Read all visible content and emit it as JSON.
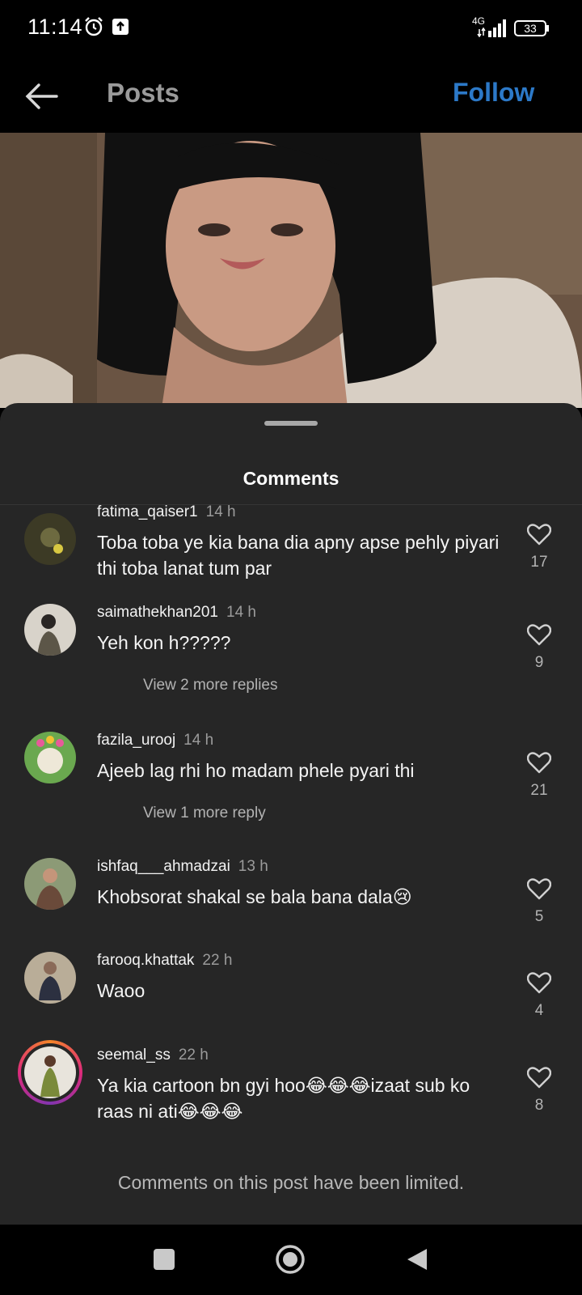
{
  "status_bar": {
    "time": "11:14",
    "network": "4G",
    "battery": "33"
  },
  "header": {
    "title": "Posts",
    "follow_label": "Follow"
  },
  "sheet": {
    "title": "Comments",
    "limited_notice": "Comments on this post have been limited."
  },
  "comments": [
    {
      "username": "fatima_qaiser1",
      "time": "14 h",
      "text": "Toba toba ye kia bana dia apny apse pehly piyari thi toba lanat tum par",
      "likes": "17"
    },
    {
      "username": "saimathekhan201",
      "time": "14 h",
      "text": "Yeh kon h?????",
      "likes": "9",
      "replies": "View 2 more replies"
    },
    {
      "username": "fazila_urooj",
      "time": "14 h",
      "text": "Ajeeb lag rhi ho madam phele pyari thi",
      "likes": "21",
      "replies": "View 1 more reply"
    },
    {
      "username": "ishfaq___ahmadzai",
      "time": "13 h",
      "text": "Khobsorat shakal se bala bana dala😢",
      "likes": "5"
    },
    {
      "username": "farooq.khattak",
      "time": "22 h",
      "text": "Waoo",
      "likes": "4"
    },
    {
      "username": "seemal_ss",
      "time": "22 h",
      "text": "Ya kia cartoon bn gyi hoo😂😂😂izaat sub ko raas ni ati😂😂😂",
      "likes": "8"
    }
  ],
  "icons": {
    "back": "arrow-left-icon",
    "like": "heart-outline-icon",
    "alarm": "alarm-clock-icon",
    "upload": "upload-icon",
    "signal": "cell-signal-icon",
    "battery": "battery-icon"
  },
  "colors": {
    "follow": "#2c79c8",
    "sheet_bg": "#262626",
    "story_ring": "#dd2a7b"
  }
}
